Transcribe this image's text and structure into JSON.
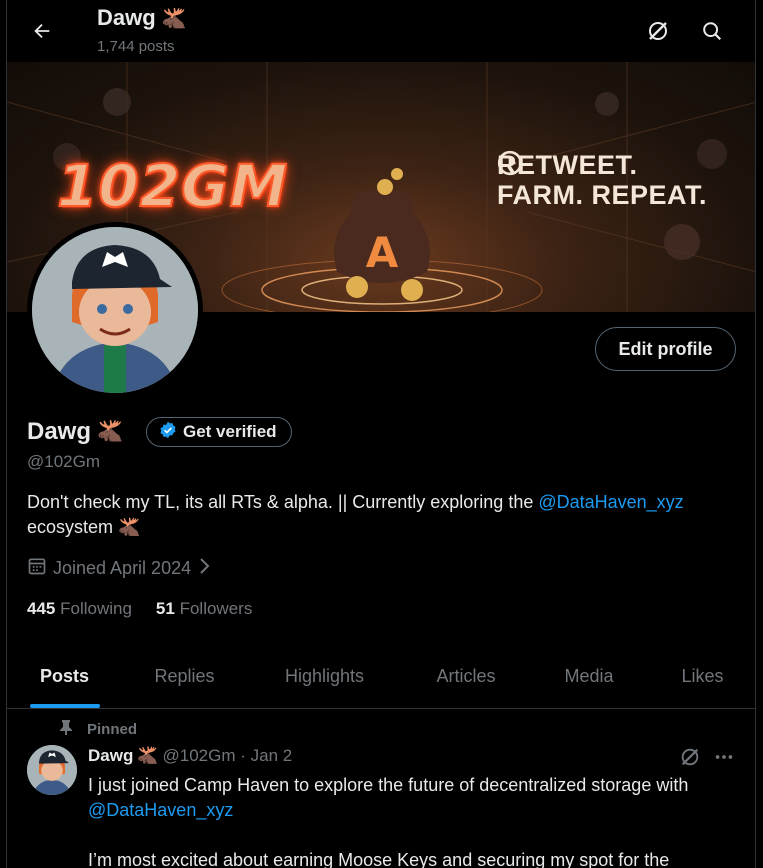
{
  "header": {
    "name": "Dawg",
    "posts_count": "1,744 posts"
  },
  "banner": {
    "left_text": "102GM",
    "right_line1": "RETWEET.",
    "right_line2": "FARM. REPEAT."
  },
  "profile": {
    "edit_label": "Edit profile",
    "name": "Dawg",
    "verify_label": "Get verified",
    "handle": "@102Gm",
    "bio_text": "Don't check my TL, its all RTs & alpha. || Currently exploring the ",
    "bio_link": "@DataHaven_xyz",
    "bio_tail": "ecosystem",
    "joined": "Joined April 2024",
    "following_count": "445",
    "following_label": "Following",
    "followers_count": "51",
    "followers_label": "Followers"
  },
  "tabs": [
    {
      "label": "Posts"
    },
    {
      "label": "Replies"
    },
    {
      "label": "Highlights"
    },
    {
      "label": "Articles"
    },
    {
      "label": "Media"
    },
    {
      "label": "Likes"
    }
  ],
  "post": {
    "pinned_label": "Pinned",
    "name": "Dawg",
    "handle_date": "@102Gm · Jan 2",
    "line1": "I just joined Camp Haven to explore the future of decentralized storage with",
    "link": "@DataHaven_xyz",
    "line3": "I’m most excited about earning Moose Keys and securing my spot for the"
  },
  "colors": {
    "accent": "#1d9bf0",
    "muted": "#71767b",
    "text": "#e7e9ea",
    "border": "#2f3336"
  }
}
